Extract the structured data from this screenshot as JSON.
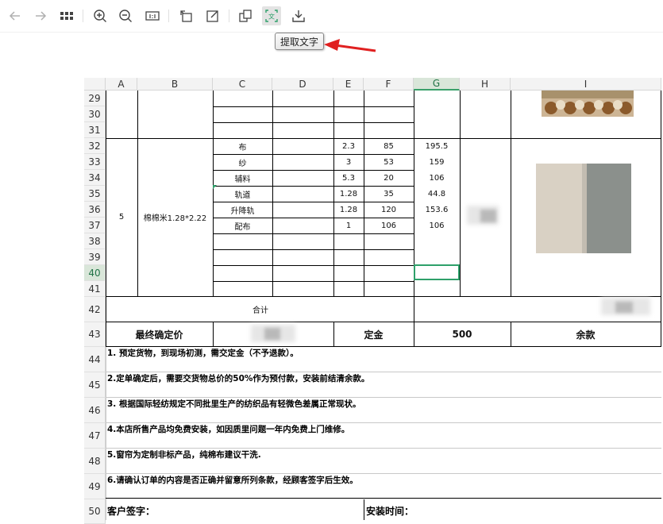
{
  "tooltip": "提取文字",
  "toolbar": {
    "icons": [
      "back-arrow-icon",
      "forward-arrow-icon",
      "grid-icon",
      "zoom-in-icon",
      "zoom-out-icon",
      "actual-size-icon",
      "rotate-icon",
      "edit-icon",
      "copy-icon",
      "extract-text-icon",
      "save-icon"
    ]
  },
  "columns": [
    "A",
    "B",
    "C",
    "D",
    "E",
    "F",
    "G",
    "H",
    "I"
  ],
  "rows": [
    "29",
    "30",
    "31",
    "32",
    "33",
    "34",
    "35",
    "36",
    "37",
    "38",
    "39",
    "40",
    "41",
    "42",
    "43",
    "44",
    "45",
    "46",
    "47",
    "48",
    "49",
    "50"
  ],
  "item": {
    "no": "5",
    "name": "棉棉米1.28*2.22",
    "lines": [
      {
        "item": "布",
        "qty": "2.3",
        "price": "85",
        "amount": "195.5"
      },
      {
        "item": "纱",
        "qty": "3",
        "price": "53",
        "amount": "159"
      },
      {
        "item": "辅料",
        "qty": "5.3",
        "price": "20",
        "amount": "106"
      },
      {
        "item": "轨道",
        "qty": "1.28",
        "price": "35",
        "amount": "44.8"
      },
      {
        "item": "升降轨",
        "qty": "1.28",
        "price": "120",
        "amount": "153.6"
      },
      {
        "item": "配布",
        "qty": "1",
        "price": "106",
        "amount": "106"
      }
    ]
  },
  "total_label": "合计",
  "final_price_label": "最终确定价",
  "deposit_label": "定金",
  "deposit_value": "500",
  "balance_label": "余款",
  "notes": [
    "1. 预定货物，到现场初测，需交定金（不予退款）。",
    "2.定单确定后，需要交货物总价的50%作为预付款，安装前结清余款。",
    "3. 根据国际轻纺规定不同批里生产的纺织品有轻微色差属正常现状。",
    "4.本店所售产品均免费安装，如因质里问题一年内免费上门维修。",
    "5.窗帘为定制非标产品，纯棉布建议干洗.",
    "6.请确认订单的内容是否正确并留意所列条款，经顾客签字后生效。"
  ],
  "signature_label": "客户签字：",
  "install_time_label": "安装时间："
}
